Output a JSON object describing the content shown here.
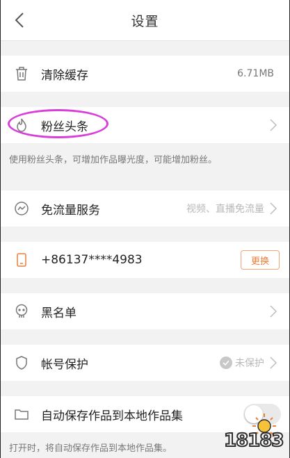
{
  "header": {
    "title": "设置"
  },
  "rows": {
    "clear_cache": {
      "label": "清除缓存",
      "value": "6.71MB"
    },
    "fans_headline": {
      "label": "粉丝头条",
      "note": "使用粉丝头条，可增加作品曝光度，可能增加粉丝。"
    },
    "free_data": {
      "label": "免流量服务",
      "value": "视频、直播免流量"
    },
    "phone": {
      "label": "+86137****4983",
      "button": "更换"
    },
    "blacklist": {
      "label": "黑名单"
    },
    "account_protection": {
      "label": "帐号保护",
      "status": "未保护"
    },
    "auto_save": {
      "label": "自动保存作品到本地作品集",
      "note": "打开时，将自动保存作品到本地作品集。",
      "enabled": false
    }
  },
  "watermark": {
    "text": "18183"
  },
  "colors": {
    "accent": "#f07c35",
    "highlight_ellipse": "#d73fd7"
  }
}
